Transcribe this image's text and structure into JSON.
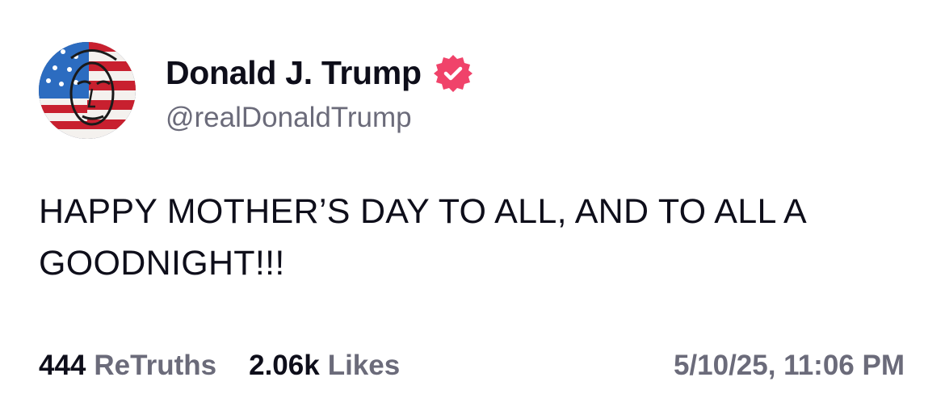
{
  "author": {
    "display_name": "Donald J. Trump",
    "handle": "@realDonaldTrump",
    "verified": true,
    "verified_icon": "verified-badge-icon",
    "verified_color": "#f0436a",
    "avatar_icon": "profile-avatar-flag-portrait"
  },
  "post": {
    "text": "HAPPY MOTHER’S DAY TO ALL, AND TO ALL A GOODNIGHT!!!"
  },
  "stats": {
    "retruths_count": "444",
    "retruths_label": "ReTruths",
    "likes_count": "2.06k",
    "likes_label": "Likes"
  },
  "timestamp": "5/10/25, 11:06 PM",
  "colors": {
    "primary_text": "#0e0e1a",
    "secondary_text": "#6b6b7a",
    "background": "#ffffff"
  }
}
